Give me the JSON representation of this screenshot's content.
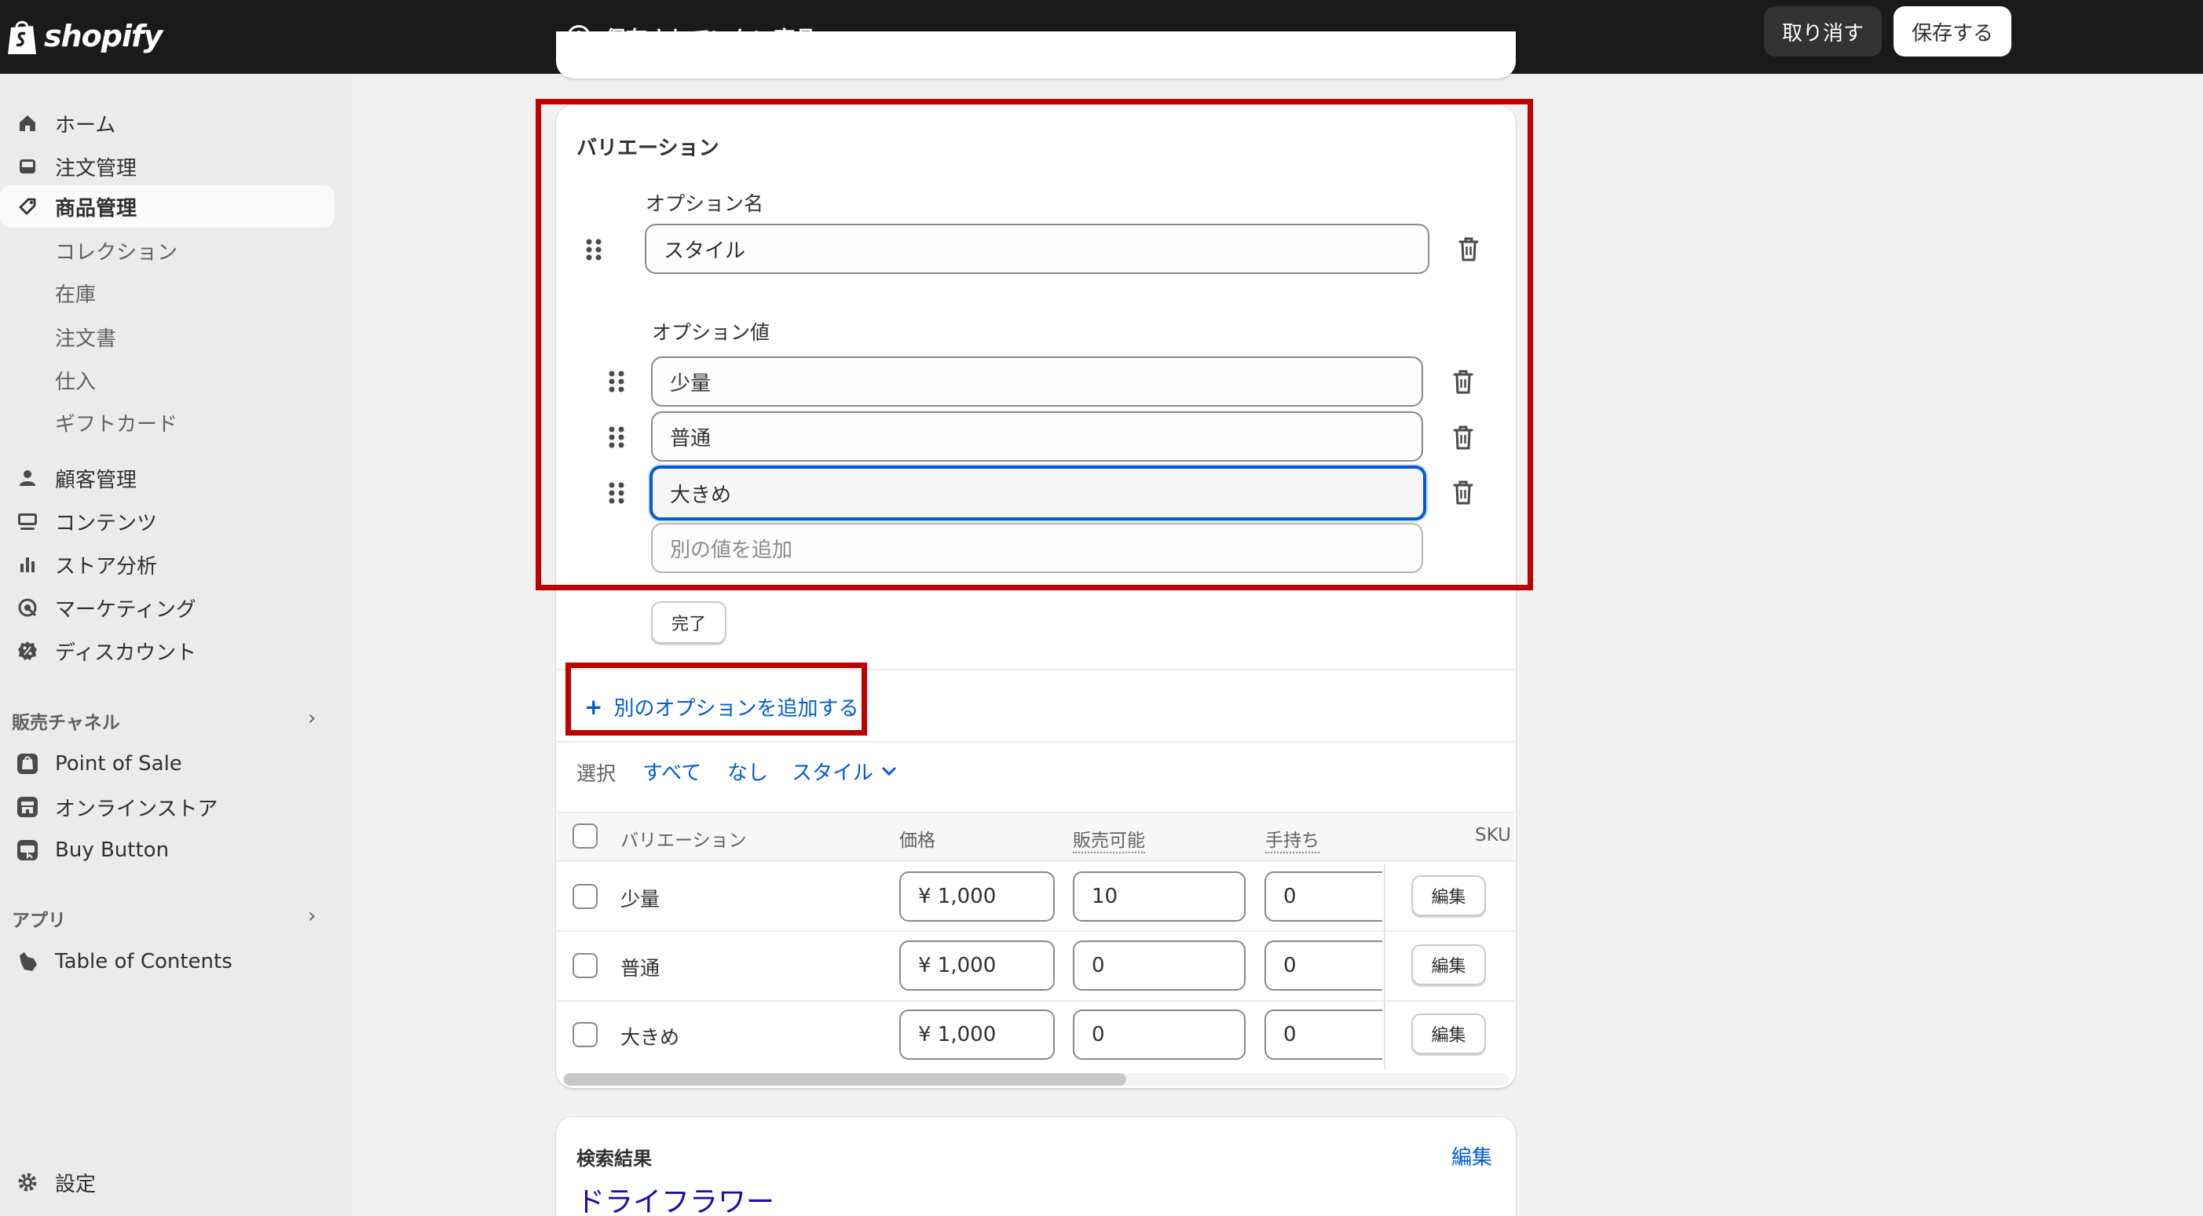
{
  "brand": {
    "logo_text": "shopify"
  },
  "topbar": {
    "unsaved_text": "保存されていない商品",
    "discard_label": "取り消す",
    "save_label": "保存する"
  },
  "sidebar": {
    "items": [
      {
        "label": "ホーム",
        "icon": "home-icon"
      },
      {
        "label": "注文管理",
        "icon": "inbox-icon"
      },
      {
        "label": "商品管理",
        "icon": "tag-icon",
        "active": true
      }
    ],
    "product_sub": [
      "コレクション",
      "在庫",
      "注文書",
      "仕入",
      "ギフトカード"
    ],
    "items2": [
      {
        "label": "顧客管理",
        "icon": "person-icon"
      },
      {
        "label": "コンテンツ",
        "icon": "content-icon"
      },
      {
        "label": "ストア分析",
        "icon": "bar-chart-icon"
      },
      {
        "label": "マーケティング",
        "icon": "target-icon"
      },
      {
        "label": "ディスカウント",
        "icon": "discount-icon"
      }
    ],
    "sales_channels_title": "販売チャネル",
    "channels": [
      {
        "label": "Point of Sale",
        "icon": "pos-icon"
      },
      {
        "label": "オンラインストア",
        "icon": "store-icon"
      },
      {
        "label": "Buy Button",
        "icon": "buy-button-icon"
      }
    ],
    "apps_title": "アプリ",
    "apps": [
      {
        "label": "Table of Contents",
        "icon": "dog-app-icon"
      }
    ],
    "settings_label": "設定"
  },
  "variations": {
    "title": "バリエーション",
    "option_name_label": "オプション名",
    "option_name_value": "スタイル",
    "option_values_label": "オプション値",
    "values": [
      "少量",
      "普通",
      "大きめ"
    ],
    "add_value_placeholder": "別の値を追加",
    "done_label": "完了",
    "add_option_label": "別のオプションを追加する",
    "select": {
      "label": "選択",
      "all": "すべて",
      "none": "なし",
      "style": "スタイル"
    },
    "table": {
      "headers": {
        "variation": "バリエーション",
        "price": "価格",
        "available": "販売可能",
        "on_hand": "手持ち",
        "sku": "SKU"
      },
      "rows": [
        {
          "name": "少量",
          "price": "¥ 1,000",
          "available": "10",
          "on_hand": "0",
          "edit": "編集"
        },
        {
          "name": "普通",
          "price": "¥ 1,000",
          "available": "0",
          "on_hand": "0",
          "edit": "編集"
        },
        {
          "name": "大きめ",
          "price": "¥ 1,000",
          "available": "0",
          "on_hand": "0",
          "edit": "編集"
        }
      ]
    }
  },
  "search": {
    "title": "検索結果",
    "edit_label": "編集",
    "preview_title": "ドライフラワー"
  },
  "colors": {
    "accent": "#005bd3",
    "highlight": "#c00000",
    "topbar": "#1a1a1a"
  }
}
